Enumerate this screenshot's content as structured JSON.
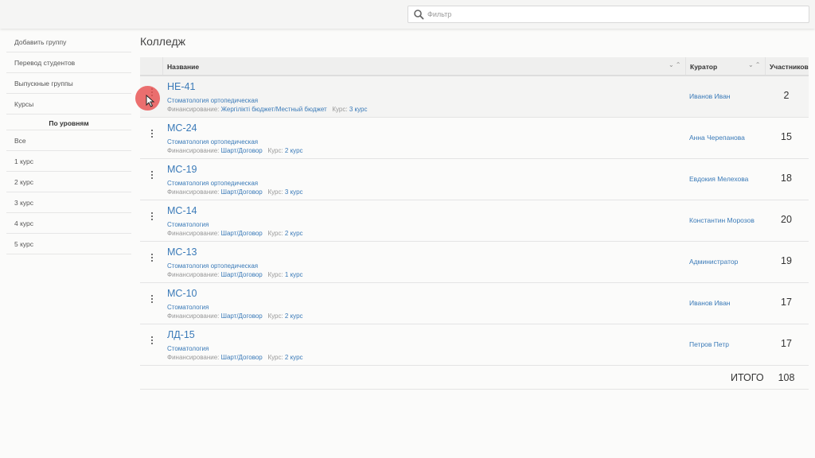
{
  "filter": {
    "placeholder": "Фильтр"
  },
  "sidebar": {
    "actions": [
      "Добавить группу",
      "Перевод студентов",
      "Выпускные группы",
      "Курсы"
    ],
    "levels_header": "По уровням",
    "levels": [
      "Все",
      "1 курс",
      "2 курс",
      "3 курс",
      "4 курс",
      "5 курс"
    ]
  },
  "page": {
    "title": "Колледж"
  },
  "table": {
    "columns": {
      "name": "Название",
      "curator": "Куратор",
      "count": "Участников"
    },
    "fin_label": "Финансирование:",
    "course_label": "Курс:",
    "rows": [
      {
        "name": "НЕ-41",
        "specialty": "Стоматология ортопедическая",
        "funding": "Жергілікті бюджет/Местный бюджет",
        "course": "3 курс",
        "curator": "Иванов Иван",
        "count": "2"
      },
      {
        "name": "МС-24",
        "specialty": "Стоматология ортопедическая",
        "funding": "Шарт/Договор",
        "course": "2 курс",
        "curator": "Анна Черепанова",
        "count": "15"
      },
      {
        "name": "МС-19",
        "specialty": "Стоматология ортопедическая",
        "funding": "Шарт/Договор",
        "course": "3 курс",
        "curator": "Евдокия Мелехова",
        "count": "18"
      },
      {
        "name": "МС-14",
        "specialty": "Стоматология",
        "funding": "Шарт/Договор",
        "course": "2 курс",
        "curator": "Константин Морозов",
        "count": "20"
      },
      {
        "name": "МС-13",
        "specialty": "Стоматология ортопедическая",
        "funding": "Шарт/Договор",
        "course": "1 курс",
        "curator": "Администратор",
        "count": "19"
      },
      {
        "name": "МС-10",
        "specialty": "Стоматология",
        "funding": "Шарт/Договор",
        "course": "2 курс",
        "curator": "Иванов Иван",
        "count": "17"
      },
      {
        "name": "ЛД-15",
        "specialty": "Стоматология",
        "funding": "Шарт/Договор",
        "course": "2 курс",
        "curator": "Петров Петр",
        "count": "17"
      }
    ],
    "total_label": "ИТОГО",
    "total_value": "108"
  },
  "icons": {
    "search": "search-icon",
    "menu": "kebab-menu-icon",
    "sort": "sort-chevrons-icon"
  },
  "colors": {
    "link": "#3a7ab8",
    "highlight": "#e85050"
  }
}
